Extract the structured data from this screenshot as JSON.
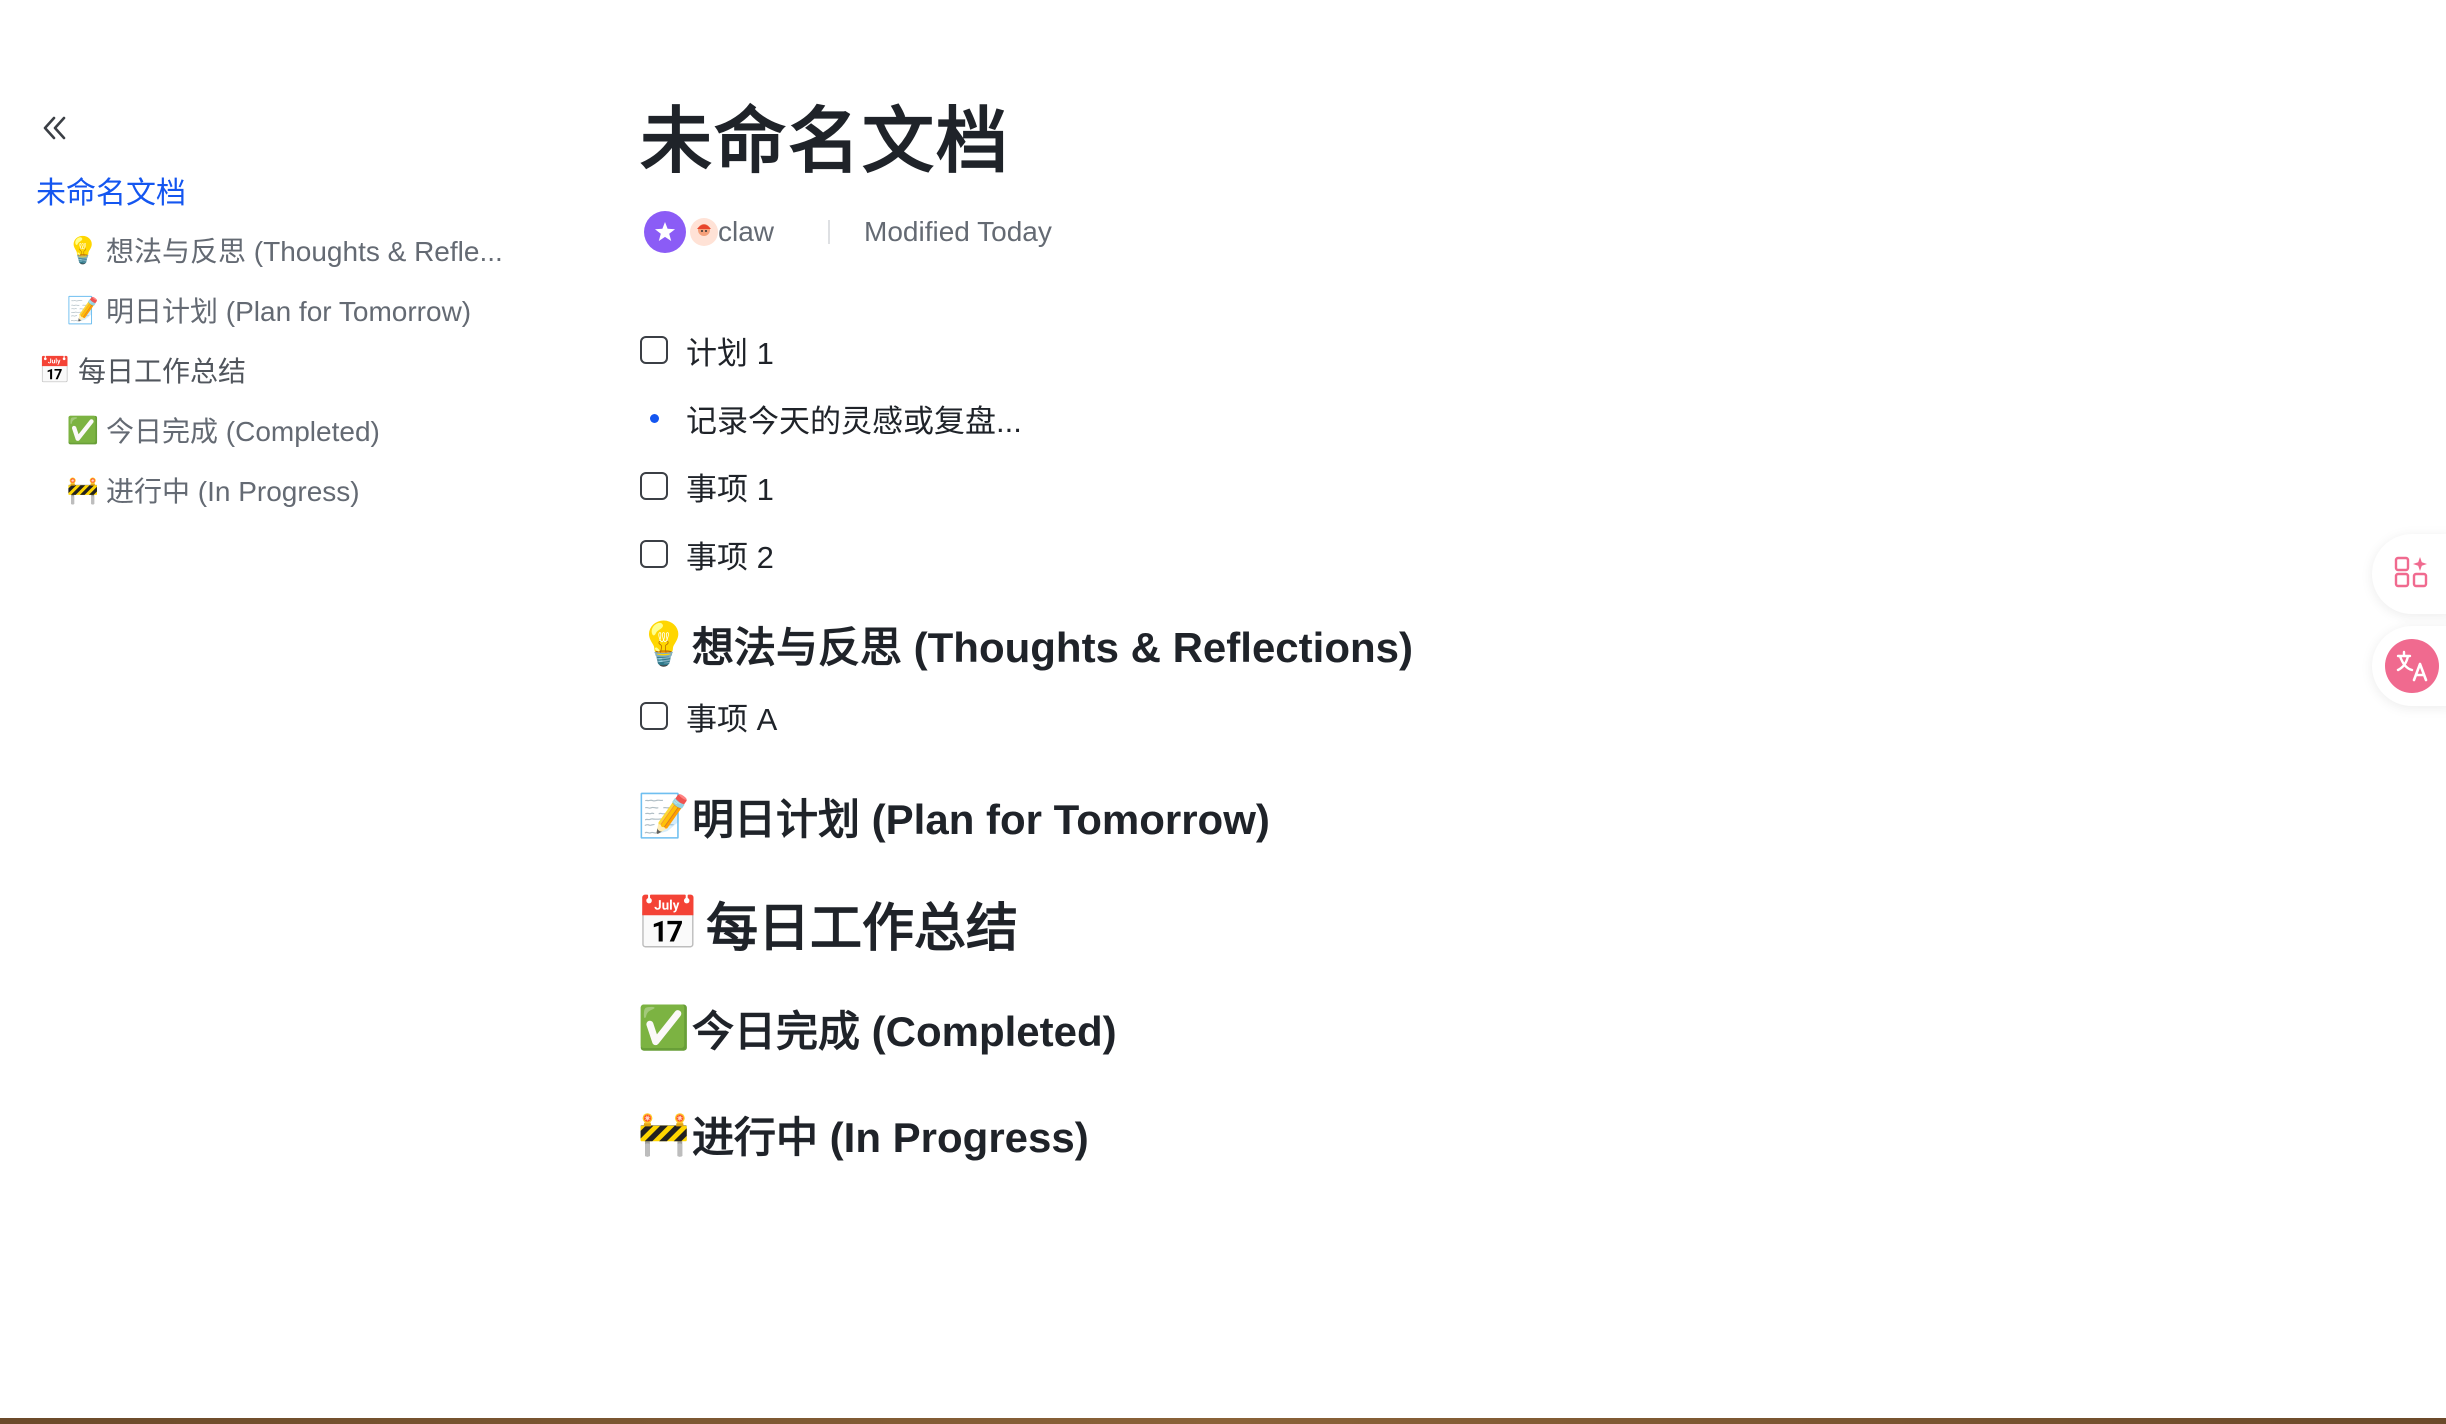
{
  "sidebar": {
    "items": [
      {
        "label": "未命名文档",
        "emoji": ""
      },
      {
        "label": "想法与反思 (Thoughts & Refle...",
        "emoji": "💡"
      },
      {
        "label": "明日计划 (Plan for Tomorrow)",
        "emoji": "📝"
      },
      {
        "label": "每日工作总结",
        "emoji": "📅"
      },
      {
        "label": "今日完成 (Completed)",
        "emoji": "✅"
      },
      {
        "label": "进行中 (In Progress)",
        "emoji": "🚧"
      }
    ]
  },
  "doc": {
    "title": "未命名文档",
    "owner": "claw",
    "modified": "Modified Today",
    "blocks": {
      "todo1": "计划 1",
      "bullet1": "记录今天的灵感或复盘...",
      "todo2": "事项 1",
      "todo3": "事项 2",
      "heading_thoughts": "想法与反思 (Thoughts & Reflections)",
      "todo4": "事项 A",
      "heading_plan": "明日计划 (Plan for Tomorrow)",
      "heading_daily": "每日工作总结",
      "heading_completed": "今日完成 (Completed)",
      "heading_progress": "进行中 (In Progress)"
    },
    "emojis": {
      "thoughts": "💡",
      "plan": "📝",
      "daily": "📅",
      "completed": "✅",
      "progress": "🚧"
    }
  },
  "icons": {
    "collapse": "double-chevron-left-icon",
    "app_widgets": "apps-sparkle-icon",
    "translate": "translate-icon"
  },
  "colors": {
    "accent": "#1456f0",
    "text": "#1f2329",
    "muted": "#646a73",
    "float_icon": "#f06a8f"
  }
}
